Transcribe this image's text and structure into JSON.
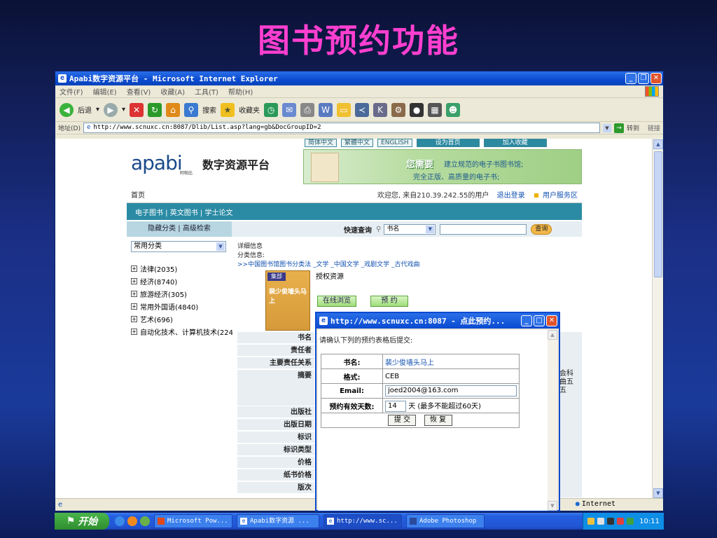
{
  "slide": {
    "title": "图书预约功能"
  },
  "window": {
    "title": "Apabi数字资源平台 - Microsoft Internet Explorer",
    "menu": [
      "文件(F)",
      "编辑(E)",
      "查看(V)",
      "收藏(A)",
      "工具(T)",
      "帮助(H)"
    ],
    "toolbar": {
      "back": "后退",
      "search": "搜索",
      "favorites": "收藏夹"
    },
    "address": {
      "label": "地址(D)",
      "url": "http://www.scnuxc.cn:8087/Dlib/List.asp?lang=gb&DocGroupID=2",
      "go": "转到",
      "links": "链接"
    },
    "status": {
      "zone": "Internet"
    }
  },
  "page": {
    "lang_buttons": [
      "简体中文",
      "繁體中文",
      "ENGLISH",
      "设为首页",
      "加入收藏"
    ],
    "logo": "apabi",
    "logo_sub": "阿帕比",
    "site_name": "数字资源平台",
    "banner": {
      "need": "您需要",
      "line1": "建立规范的电子书图书馆;",
      "line2": "完全正版、高质量的电子书;"
    },
    "home": "首页",
    "welcome": "欢迎您, 来自210.39.242.55的用户",
    "logout": "退出登录",
    "user_area": "用户服务区",
    "nav": "电子图书 | 英文图书 | 学士论文",
    "tabs": "隐藏分类 | 高级检索",
    "quick_search": "快速查询",
    "search_field": "书名",
    "search_button": "查询",
    "category_select": "常用分类",
    "categories": [
      "法律(2035)",
      "经济(8740)",
      "旅游经济(305)",
      "常用外国语(4840)",
      "艺术(696)",
      "自动化技术、计算机技术(224"
    ],
    "detail_label": "详细信息",
    "class_label": "分类信息:",
    "class_path": ">>中国图书馆图书分类法 _文学 _中国文学 _戏剧文学 _古代戏曲",
    "book_tag": "集部",
    "book_cover_title": "裴少俊墙头马上",
    "auth": "授权资源",
    "online_button": "在线浏览",
    "reserve_button": "预 约",
    "fields": [
      "书名",
      "责任者",
      "主要责任关系",
      "摘要",
      "出版社",
      "出版日期",
      "标识",
      "标识类型",
      "价格",
      "纸书价格",
      "版次"
    ],
    "right_fragment": [
      "会科",
      "曲五",
      "五"
    ]
  },
  "popup": {
    "title": "http://www.scnuxc.cn:8087 - 点此预约...",
    "prompt": "请确认下列的预约表格后提交:",
    "book_label": "书名:",
    "book_value": "裴少俊墙头马上",
    "format_label": "格式:",
    "format_value": "CEB",
    "email_label": "Email:",
    "email_value": "joed2004@163.com",
    "days_label": "预约有效天数:",
    "days_value": "14",
    "days_note": "天 (最多不能超过60天)",
    "submit": "提 交",
    "reset": "恢 复"
  },
  "taskbar": {
    "start": "开始",
    "tasks": [
      "Microsoft Pow...",
      "Apabi数字资源 ...",
      "http://www.sc...",
      "Adobe Photoshop"
    ],
    "clock": "10:11"
  }
}
